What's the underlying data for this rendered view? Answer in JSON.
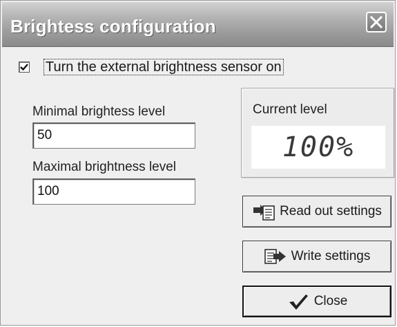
{
  "window": {
    "title": "Brightess configuration",
    "close_icon": "close-x-icon"
  },
  "sensor": {
    "label": "Turn the external brightness sensor on",
    "checked": true
  },
  "minimal": {
    "label": "Minimal brightess level",
    "value": "50"
  },
  "maximal": {
    "label": "Maximal brightness level",
    "value": "100"
  },
  "current": {
    "label": "Current level",
    "value": "100%"
  },
  "buttons": {
    "read_out": {
      "label": "Read out settings",
      "icon": "read-out-icon"
    },
    "write": {
      "label": "Write settings",
      "icon": "write-icon"
    },
    "close": {
      "label": "Close",
      "icon": "checkmark-icon"
    }
  },
  "colors": {
    "titlebar": "#9b9b9b",
    "window_bg": "#efefef",
    "display_bg": "#ffffff"
  }
}
